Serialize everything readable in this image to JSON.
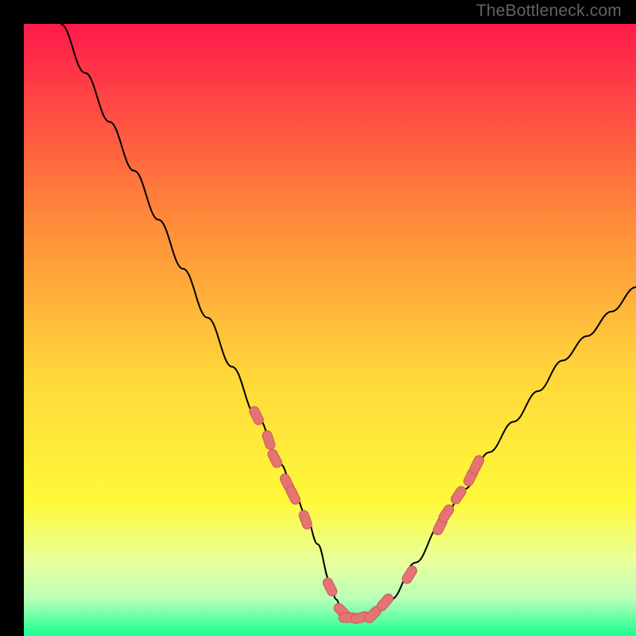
{
  "watermark": "TheBottleneck.com",
  "colors": {
    "grad_top": "#ff1a4b",
    "grad_mid1": "#ff8a3a",
    "grad_mid2": "#ffd83a",
    "grad_mid3": "#fff93a",
    "grad_low1": "#e8ff9c",
    "grad_low2": "#b8ffb8",
    "grad_bottom": "#17ff8f",
    "curve": "#000000",
    "marker_fill": "#e57373",
    "marker_stroke": "#c85a5a",
    "frame": "#000000"
  },
  "chart_data": {
    "type": "line",
    "title": "",
    "xlabel": "",
    "ylabel": "",
    "xlim": [
      0,
      100
    ],
    "ylim": [
      0,
      100
    ],
    "annotations": [],
    "series": [
      {
        "name": "curve",
        "x": [
          6,
          10,
          14,
          18,
          22,
          26,
          30,
          34,
          38,
          42,
          44,
          46,
          48,
          50,
          51,
          52,
          54,
          56,
          58,
          60,
          64,
          68,
          72,
          76,
          80,
          84,
          88,
          92,
          96,
          100
        ],
        "values": [
          100,
          92,
          84,
          76,
          68,
          60,
          52,
          44,
          36,
          28,
          24,
          20,
          15,
          9,
          6,
          4,
          3,
          3,
          4,
          6,
          12,
          18,
          24,
          30,
          35,
          40,
          45,
          49,
          53,
          57
        ]
      }
    ],
    "markers": [
      {
        "x": 38,
        "y": 36
      },
      {
        "x": 40,
        "y": 32
      },
      {
        "x": 41,
        "y": 29
      },
      {
        "x": 43,
        "y": 25
      },
      {
        "x": 44,
        "y": 23
      },
      {
        "x": 46,
        "y": 19
      },
      {
        "x": 50,
        "y": 8
      },
      {
        "x": 52,
        "y": 4
      },
      {
        "x": 53,
        "y": 3
      },
      {
        "x": 55,
        "y": 3
      },
      {
        "x": 57,
        "y": 3.5
      },
      {
        "x": 59,
        "y": 5.5
      },
      {
        "x": 63,
        "y": 10
      },
      {
        "x": 68,
        "y": 18
      },
      {
        "x": 69,
        "y": 20
      },
      {
        "x": 71,
        "y": 23
      },
      {
        "x": 73,
        "y": 26
      },
      {
        "x": 74,
        "y": 28
      }
    ]
  }
}
